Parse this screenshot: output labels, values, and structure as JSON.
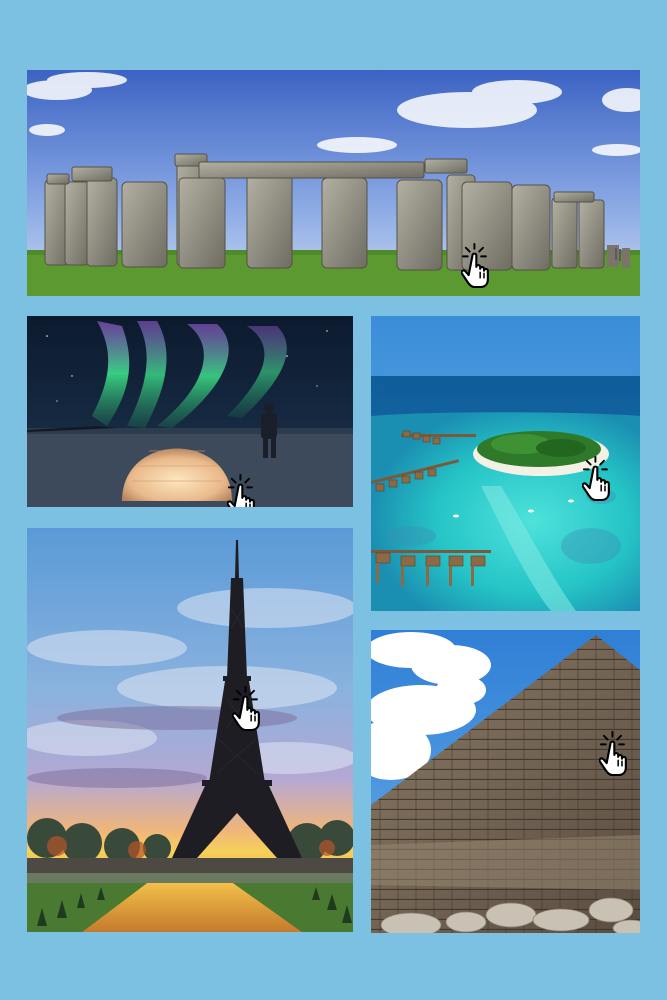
{
  "collage": {
    "background": "#7dc1e2",
    "photos": [
      {
        "id": "stonehenge",
        "subject": "stonehenge-photo",
        "cursor_icon": "hand-pointer-click-icon"
      },
      {
        "id": "aurora",
        "subject": "igloo-aurora-photo",
        "cursor_icon": "hand-pointer-click-icon"
      },
      {
        "id": "maldives",
        "subject": "island-resort-photo",
        "cursor_icon": "hand-pointer-click-icon"
      },
      {
        "id": "eiffel",
        "subject": "eiffel-tower-photo",
        "cursor_icon": "hand-pointer-click-icon"
      },
      {
        "id": "pyramid",
        "subject": "pyramid-photo",
        "cursor_icon": "hand-pointer-click-icon"
      }
    ]
  }
}
